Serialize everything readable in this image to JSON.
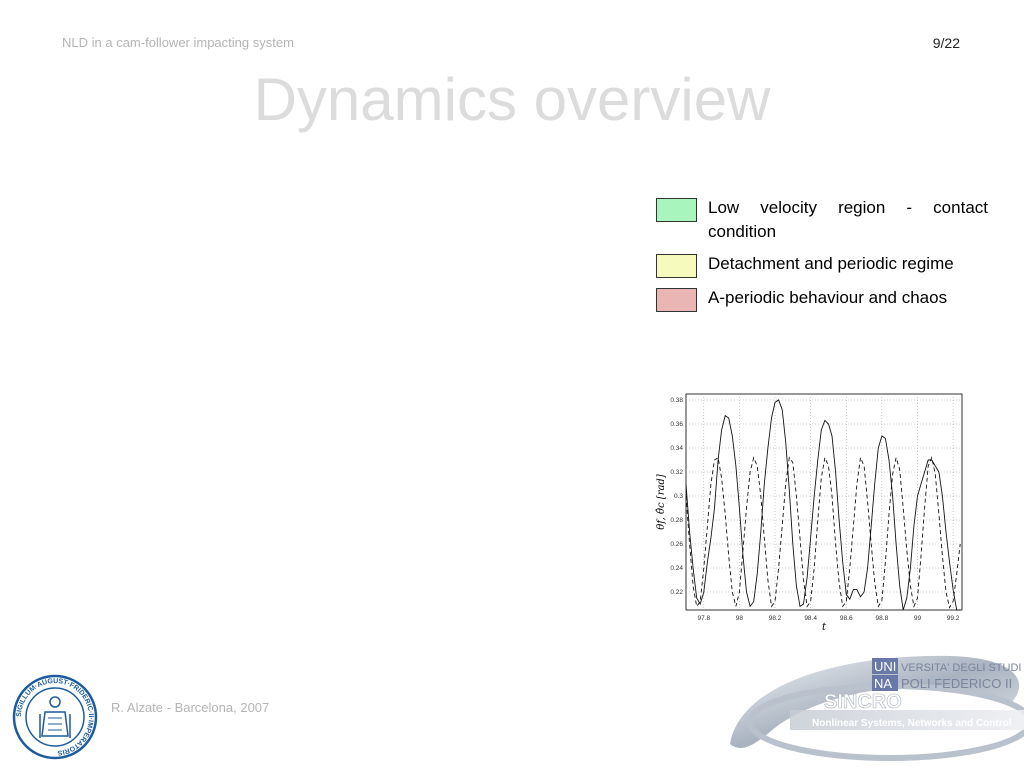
{
  "header": {
    "left_text": "NLD in a cam-follower impacting system",
    "page_number": "9/22"
  },
  "slide": {
    "title": "Dynamics overview"
  },
  "legend": [
    {
      "label": "Low velocity region - contact condition",
      "color": "#a8f5bd"
    },
    {
      "label": "Detachment and periodic regime",
      "color": "#f6fbbd"
    },
    {
      "label": "A-periodic behaviour and chaos",
      "color": "#eab5b5"
    }
  ],
  "chart_data": {
    "type": "line",
    "xlim": [
      97.7,
      99.25
    ],
    "ylim": [
      0.205,
      0.385
    ],
    "x_ticks": [
      "97.8",
      "98",
      "98.2",
      "98.4",
      "98.6",
      "98.8",
      "99",
      "99.2"
    ],
    "y_ticks": [
      "0.22",
      "0.24",
      "0.26",
      "0.28",
      "0.3",
      "0.32",
      "0.34",
      "0.36",
      "0.38"
    ],
    "xlabel": "t",
    "ylabel": "θf, θ̂c [rad]",
    "grid": true,
    "series": [
      {
        "style": "solid",
        "x": [
          97.7,
          97.72,
          97.74,
          97.76,
          97.78,
          97.8,
          97.82,
          97.84,
          97.86,
          97.88,
          97.9,
          97.92,
          97.94,
          97.96,
          97.98,
          98.0,
          98.02,
          98.04,
          98.06,
          98.08,
          98.1,
          98.12,
          98.14,
          98.16,
          98.18,
          98.2,
          98.22,
          98.24,
          98.26,
          98.28,
          98.3,
          98.32,
          98.34,
          98.36,
          98.38,
          98.4,
          98.42,
          98.44,
          98.46,
          98.48,
          98.5,
          98.52,
          98.54,
          98.56,
          98.58,
          98.6,
          98.62,
          98.64,
          98.66,
          98.68,
          98.7,
          98.72,
          98.74,
          98.76,
          98.78,
          98.8,
          98.82,
          98.84,
          98.86,
          98.88,
          98.9,
          98.92,
          98.94,
          98.96,
          98.98,
          99.0,
          99.02,
          99.04,
          99.06,
          99.08,
          99.1,
          99.12,
          99.14,
          99.16,
          99.18,
          99.2,
          99.22,
          99.24
        ],
        "y": [
          0.31,
          0.27,
          0.24,
          0.215,
          0.21,
          0.22,
          0.245,
          0.265,
          0.29,
          0.33,
          0.355,
          0.367,
          0.365,
          0.35,
          0.325,
          0.29,
          0.25,
          0.22,
          0.208,
          0.212,
          0.235,
          0.27,
          0.31,
          0.34,
          0.365,
          0.378,
          0.38,
          0.372,
          0.345,
          0.305,
          0.26,
          0.225,
          0.208,
          0.21,
          0.232,
          0.265,
          0.3,
          0.33,
          0.355,
          0.363,
          0.36,
          0.35,
          0.32,
          0.28,
          0.245,
          0.218,
          0.214,
          0.222,
          0.222,
          0.216,
          0.22,
          0.24,
          0.275,
          0.31,
          0.34,
          0.35,
          0.348,
          0.33,
          0.3,
          0.26,
          0.225,
          0.205,
          0.215,
          0.24,
          0.275,
          0.3,
          0.31,
          0.32,
          0.33,
          0.33,
          0.325,
          0.32,
          0.3,
          0.27,
          0.245,
          0.222,
          0.205,
          0.205
        ]
      },
      {
        "style": "dashed",
        "x": [
          97.7,
          97.72,
          97.74,
          97.76,
          97.78,
          97.8,
          97.82,
          97.84,
          97.86,
          97.88,
          97.9,
          97.92,
          97.94,
          97.96,
          97.98,
          98.0,
          98.02,
          98.04,
          98.06,
          98.08,
          98.1,
          98.12,
          98.14,
          98.16,
          98.18,
          98.2,
          98.22,
          98.24,
          98.26,
          98.28,
          98.3,
          98.32,
          98.34,
          98.36,
          98.38,
          98.4,
          98.42,
          98.44,
          98.46,
          98.48,
          98.5,
          98.52,
          98.54,
          98.56,
          98.58,
          98.6,
          98.62,
          98.64,
          98.66,
          98.68,
          98.7,
          98.72,
          98.74,
          98.76,
          98.78,
          98.8,
          98.82,
          98.84,
          98.86,
          98.88,
          98.9,
          98.92,
          98.94,
          98.96,
          98.98,
          99.0,
          99.02,
          99.04,
          99.06,
          99.08,
          99.1,
          99.12,
          99.14,
          99.16,
          99.18,
          99.2,
          99.22,
          99.24
        ],
        "y": [
          0.3,
          0.26,
          0.225,
          0.208,
          0.212,
          0.24,
          0.275,
          0.31,
          0.33,
          0.332,
          0.315,
          0.285,
          0.25,
          0.22,
          0.208,
          0.22,
          0.255,
          0.29,
          0.32,
          0.332,
          0.325,
          0.3,
          0.265,
          0.23,
          0.208,
          0.212,
          0.24,
          0.275,
          0.31,
          0.332,
          0.328,
          0.3,
          0.265,
          0.23,
          0.208,
          0.212,
          0.24,
          0.28,
          0.315,
          0.332,
          0.325,
          0.3,
          0.26,
          0.228,
          0.208,
          0.212,
          0.24,
          0.275,
          0.31,
          0.332,
          0.325,
          0.295,
          0.26,
          0.228,
          0.208,
          0.213,
          0.245,
          0.285,
          0.318,
          0.332,
          0.322,
          0.29,
          0.255,
          0.225,
          0.208,
          0.215,
          0.25,
          0.29,
          0.325,
          0.332,
          0.318,
          0.285,
          0.25,
          0.22,
          0.207,
          0.212,
          0.235,
          0.26
        ]
      }
    ]
  },
  "footer": {
    "author": "R. Alzate - Barcelona, 2007",
    "university_line1_a": "UNI",
    "university_line1_b": "VERSITA' DEGLI STUDI DI",
    "university_line2_a": "NA",
    "university_line2_b": "POLI FEDERICO II",
    "group_logo": "SINCRO",
    "group_tagline": "Nonlinear Systems, Networks and Control",
    "seal_text": "SIGILLUM·AUGUST·FRIDERIC·II·IMPERATORIS"
  }
}
